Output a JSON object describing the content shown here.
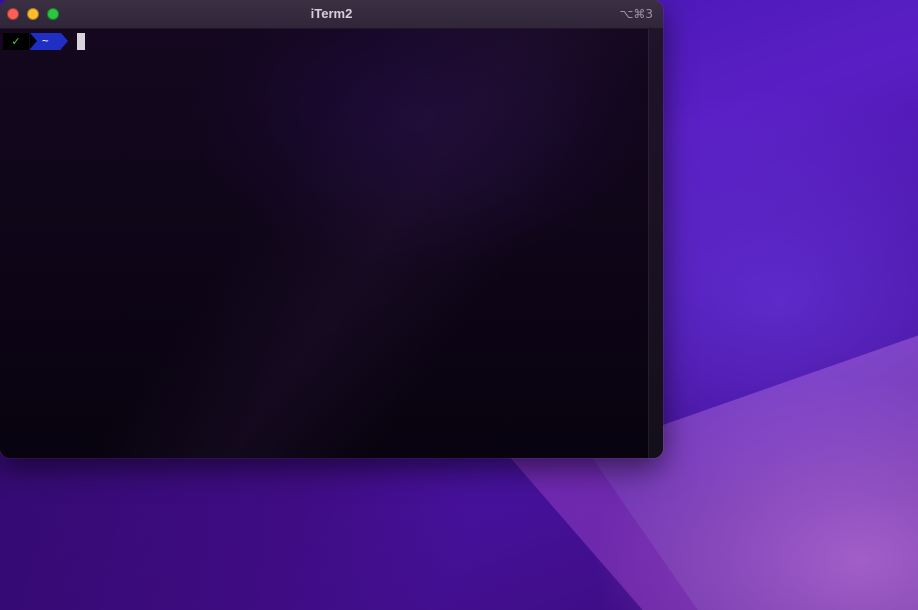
{
  "window": {
    "title": "iTerm2",
    "shortcut": "⌥⌘3"
  },
  "prompt": {
    "status_icon": "✓",
    "directory": "~"
  },
  "colors": {
    "close": "#fe5f57",
    "minimize": "#febc2e",
    "maximize": "#28c840",
    "status_fg": "#3fd15b",
    "dir_bg": "#1f2fc4"
  },
  "icons": {
    "status": "checkmark-icon"
  }
}
